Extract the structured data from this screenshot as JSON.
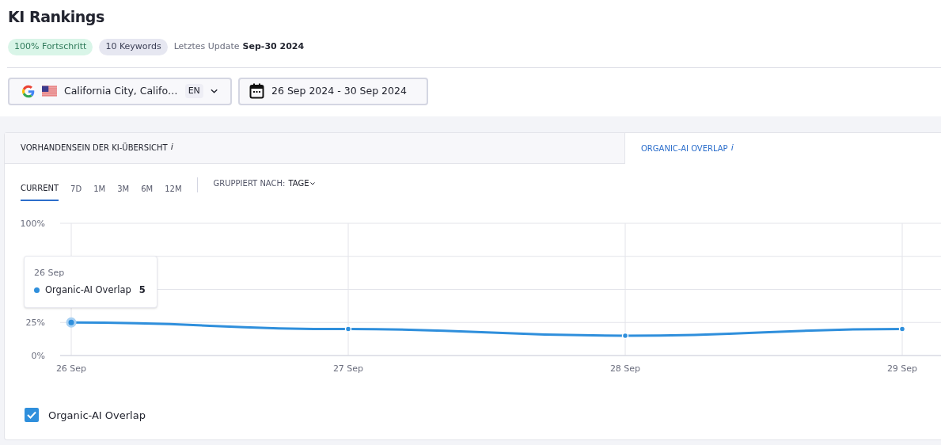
{
  "page": {
    "title": "KI Rankings",
    "badges": [
      {
        "label": "100% Fortschritt",
        "kind": "progress"
      },
      {
        "label": "10 Keywords",
        "kind": "count"
      }
    ],
    "last_update": {
      "label": "Letztes Update",
      "value": "Sep-30 2024"
    }
  },
  "location_select": {
    "value": "California City, Califo…",
    "language": "EN"
  },
  "date_range": {
    "value": "26 Sep 2024 - 30 Sep 2024"
  },
  "tabs": [
    {
      "label": "VORHANDENSEIN DER KI-ÜBERSICHT",
      "hint": "i",
      "selected": false
    },
    {
      "label": "ORGANIC-AI OVERLAP",
      "hint": "i",
      "selected": true
    }
  ],
  "periods": [
    {
      "label": "CURRENT",
      "selected": true
    },
    {
      "label": "7D",
      "selected": false
    },
    {
      "label": "1M",
      "selected": false
    },
    {
      "label": "3M",
      "selected": false
    },
    {
      "label": "6M",
      "selected": false
    },
    {
      "label": "12M",
      "selected": false
    }
  ],
  "group_by": {
    "label": "GRUPPIERT NACH:",
    "value": "TAGE"
  },
  "chart": {
    "chart_data": {
      "type": "line",
      "categories": [
        "26 Sep",
        "27 Sep",
        "28 Sep",
        "29 Sep"
      ],
      "series": [
        {
          "name": "Organic-AI Overlap",
          "color": "#2f8fdc",
          "marker": "circle",
          "values": [
            25,
            20,
            15,
            20
          ]
        }
      ],
      "grid": true,
      "ylim": [
        0,
        100
      ],
      "yticks": [
        {
          "value": 0,
          "label": "0%"
        },
        {
          "value": 25,
          "label": "25%"
        },
        {
          "value": 100,
          "label": "100%"
        }
      ]
    }
  },
  "tooltip": {
    "date": "26 Sep",
    "series": "Organic-AI Overlap",
    "value": "5"
  },
  "legend": [
    {
      "checked": true
    }
  ]
}
